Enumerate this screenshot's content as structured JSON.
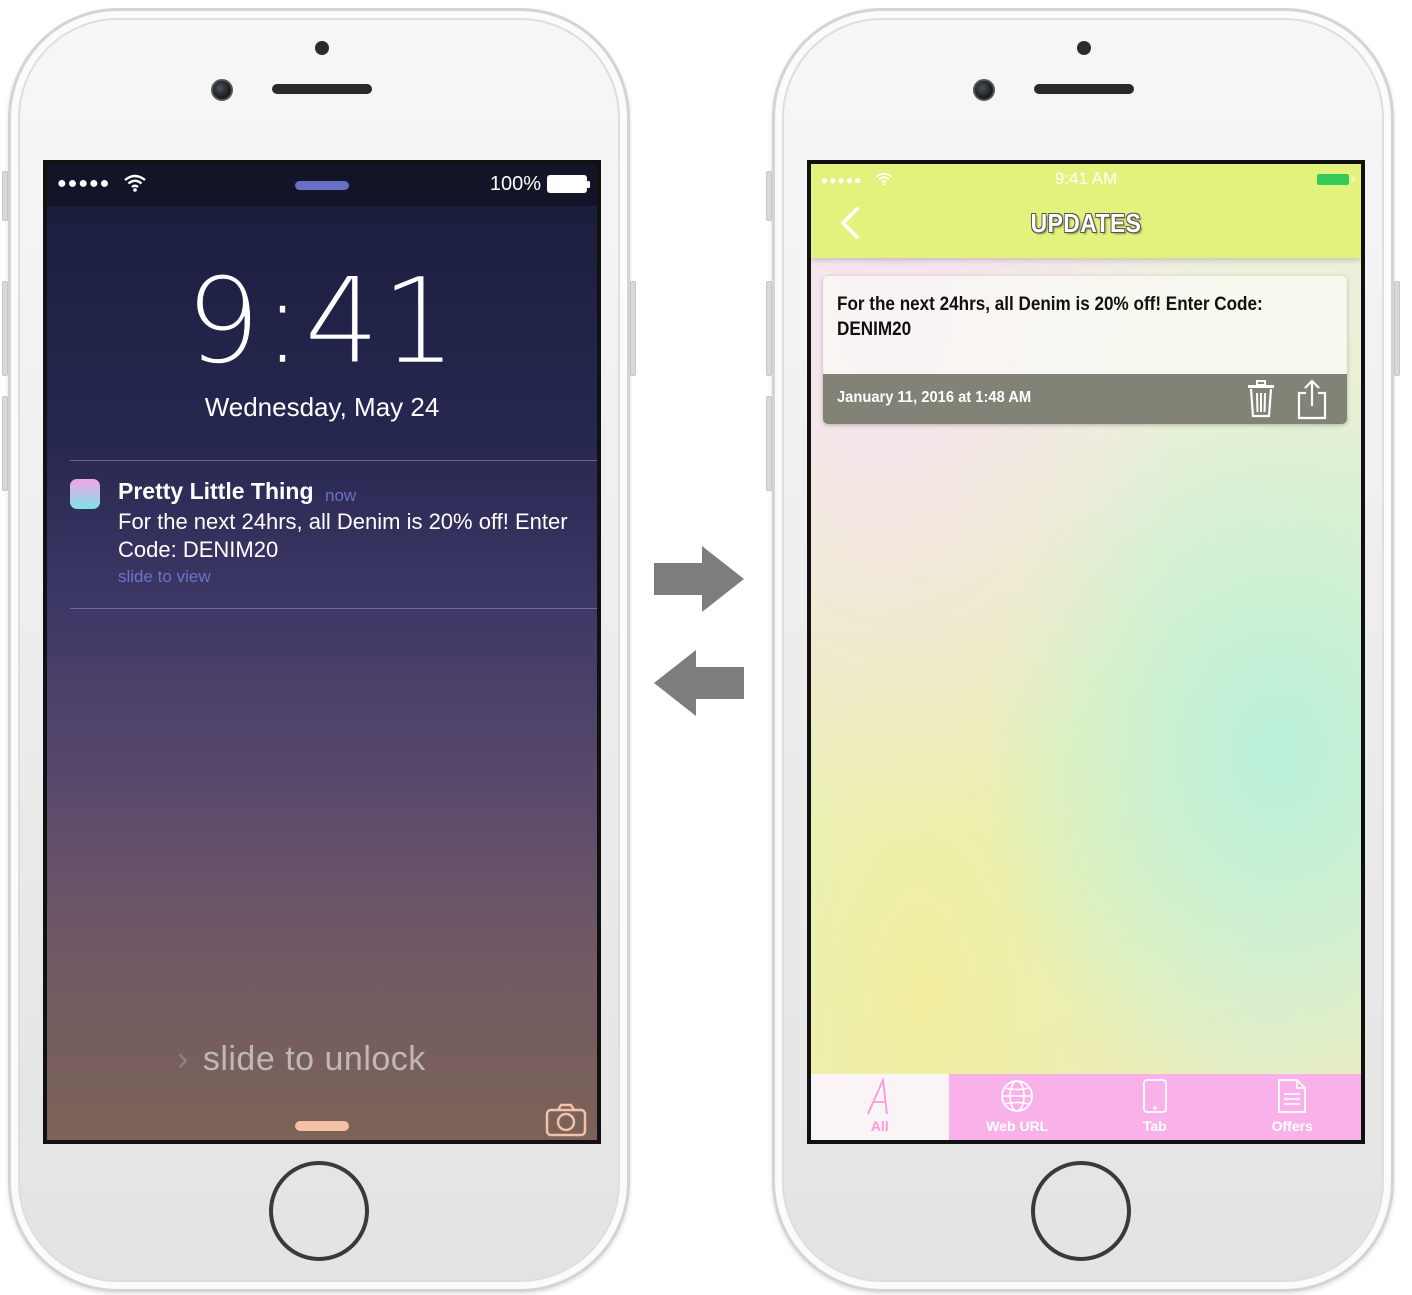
{
  "lock_screen": {
    "status": {
      "signal": "●●●●●",
      "battery": "100%"
    },
    "time": "9:41",
    "date": "Wednesday, May 24",
    "notification": {
      "app": "Pretty Little Thing",
      "time": "now",
      "body": "For the next 24hrs, all Denim is 20% off! Enter Code: DENIM20",
      "action": "slide to view"
    },
    "unlock_text": "slide to unlock",
    "unlock_chevron": "›"
  },
  "arrows": [
    "arrow-right-icon",
    "arrow-left-icon"
  ],
  "app_screen": {
    "status": {
      "signal": "●●●●●",
      "clock": "9:41 AM",
      "charging": "⚡"
    },
    "header": {
      "title": "UPDATES",
      "accent": "#e2f27c"
    },
    "message": {
      "text": "For the next 24hrs, all Denim is 20% off! Enter Code: DENIM20",
      "date": "January 11, 2016 at 1:48 AM"
    },
    "tabs": [
      {
        "label": "All",
        "icon": "letter-a-icon",
        "active": true
      },
      {
        "label": "Web URL",
        "icon": "globe-icon",
        "active": false
      },
      {
        "label": "Tab",
        "icon": "tablet-icon",
        "active": false
      },
      {
        "label": "Offers",
        "icon": "document-icon",
        "active": false
      }
    ],
    "tab_bar_color": "#f9b2e9"
  }
}
